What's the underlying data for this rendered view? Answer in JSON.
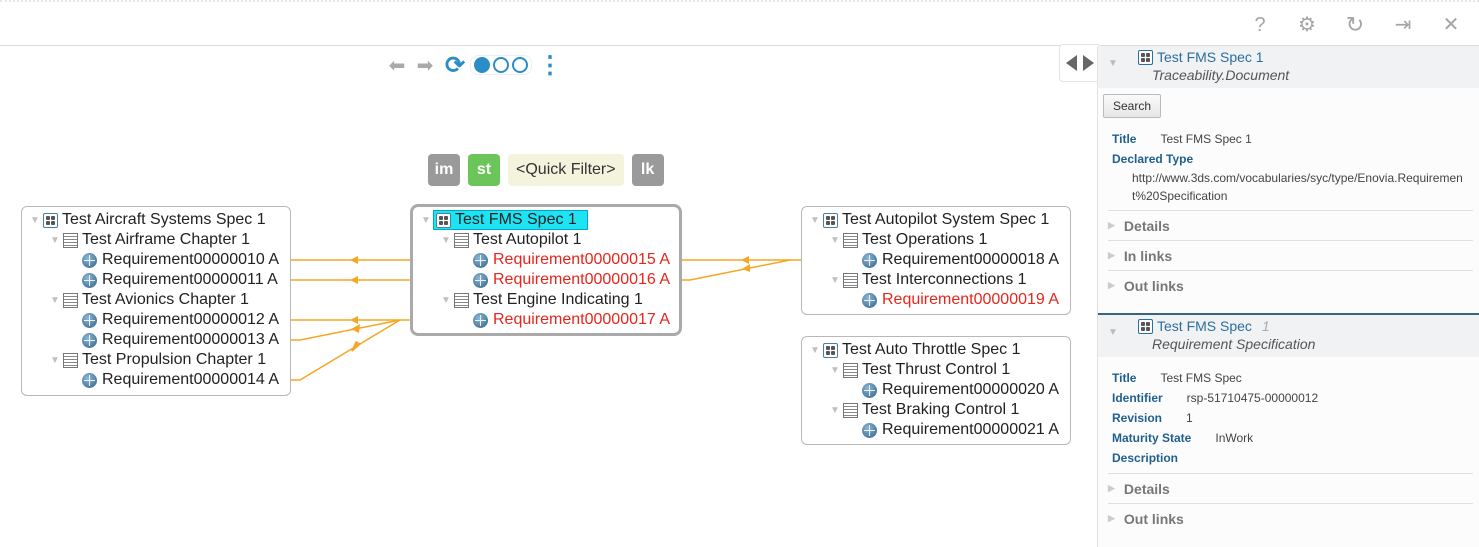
{
  "topbar": {
    "icons": [
      {
        "name": "help-icon",
        "glyph": "?"
      },
      {
        "name": "gear-icon",
        "glyph": "⚙"
      },
      {
        "name": "refresh-icon",
        "glyph": "↻"
      },
      {
        "name": "sign-in-icon",
        "glyph": "⇥"
      },
      {
        "name": "close-icon",
        "glyph": "✕"
      }
    ]
  },
  "toolbar": {
    "back_glyph": "⬅",
    "forward_glyph": "➡",
    "sync_glyph": "⟳",
    "more_glyph": "⋮",
    "pages": [
      true,
      false,
      false
    ]
  },
  "filters": {
    "im": "im",
    "st": "st",
    "quick_filter": "<Quick Filter>",
    "lk": "lk"
  },
  "colors": {
    "link": "#f5a623",
    "accent": "#2b8dc6",
    "red_text": "#e5261c",
    "selection": "#1ee3f2"
  },
  "nodes": {
    "aircraft": {
      "title": "Test Aircraft Systems Spec 1",
      "chapters": [
        {
          "title": "Test Airframe Chapter 1",
          "reqs": [
            {
              "label": "Requirement00000010 A",
              "red": false
            },
            {
              "label": "Requirement00000011 A",
              "red": false
            }
          ]
        },
        {
          "title": "Test Avionics Chapter 1",
          "reqs": [
            {
              "label": "Requirement00000012 A",
              "red": false
            },
            {
              "label": "Requirement00000013 A",
              "red": false
            }
          ]
        },
        {
          "title": "Test Propulsion Chapter 1",
          "reqs": [
            {
              "label": "Requirement00000014 A",
              "red": false
            }
          ]
        }
      ]
    },
    "fms": {
      "title": "Test FMS Spec 1",
      "chapters": [
        {
          "title": "Test Autopilot 1",
          "reqs": [
            {
              "label": "Requirement00000015 A",
              "red": true
            },
            {
              "label": "Requirement00000016 A",
              "red": true
            }
          ]
        },
        {
          "title": "Test Engine Indicating 1",
          "reqs": [
            {
              "label": "Requirement00000017 A",
              "red": true
            }
          ]
        }
      ]
    },
    "autopilot": {
      "title": "Test Autopilot System Spec 1",
      "chapters": [
        {
          "title": "Test Operations 1",
          "reqs": [
            {
              "label": "Requirement00000018 A",
              "red": false
            }
          ]
        },
        {
          "title": "Test Interconnections 1",
          "reqs": [
            {
              "label": "Requirement00000019 A",
              "red": true
            }
          ]
        }
      ]
    },
    "throttle": {
      "title": "Test Auto Throttle Spec 1",
      "chapters": [
        {
          "title": "Test Thrust Control 1",
          "reqs": [
            {
              "label": "Requirement00000020 A",
              "red": false
            }
          ]
        },
        {
          "title": "Test Braking Control 1",
          "reqs": [
            {
              "label": "Requirement00000021 A",
              "red": false
            }
          ]
        }
      ]
    }
  },
  "panel": {
    "card1": {
      "title": "Test FMS Spec 1",
      "subtitle": "Traceability.Document",
      "search_label": "Search",
      "props": {
        "title_key": "Title",
        "title_val": "Test FMS Spec 1",
        "declared_type_key": "Declared Type",
        "declared_type_val": "http://www.3ds.com/vocabularies/syc/type/Enovia.Requirement%20Specification"
      },
      "sections": [
        "Details",
        "In links",
        "Out links"
      ]
    },
    "card2": {
      "title": "Test FMS Spec",
      "version": "1",
      "subtitle": "Requirement Specification",
      "props": [
        {
          "key": "Title",
          "value": "Test FMS Spec"
        },
        {
          "key": "Identifier",
          "value": "rsp-51710475-00000012"
        },
        {
          "key": "Revision",
          "value": "1"
        },
        {
          "key": "Maturity State",
          "value": "InWork"
        },
        {
          "key": "Description",
          "value": ""
        }
      ],
      "sections": [
        "Details",
        "Out links"
      ]
    }
  }
}
